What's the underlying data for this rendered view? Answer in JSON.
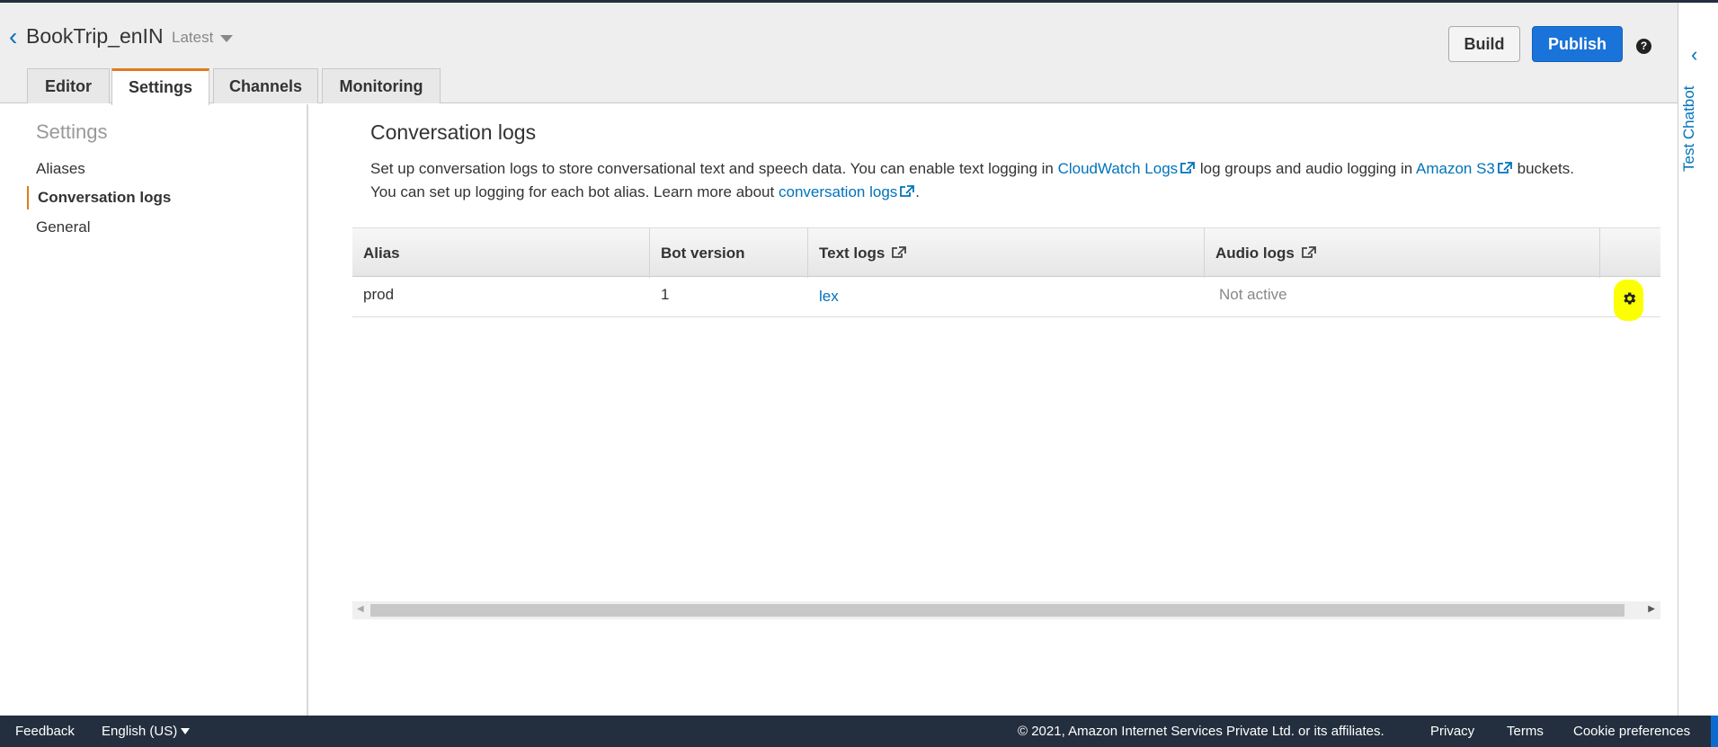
{
  "header": {
    "bot_name": "BookTrip_enIN",
    "version": "Latest",
    "build_label": "Build",
    "publish_label": "Publish",
    "help": "?",
    "tabs": [
      {
        "label": "Editor"
      },
      {
        "label": "Settings"
      },
      {
        "label": "Channels"
      },
      {
        "label": "Monitoring"
      }
    ]
  },
  "right_panel": {
    "label": "Test Chatbot"
  },
  "sidebar": {
    "title": "Settings",
    "items": [
      {
        "label": "Aliases"
      },
      {
        "label": "Conversation logs"
      },
      {
        "label": "General"
      }
    ]
  },
  "main": {
    "title": "Conversation logs",
    "desc1_a": "Set up conversation logs to store conversational text and speech data. You can enable text logging in",
    "desc1_link1": "CloudWatch Logs",
    "desc1_b": "log groups and audio logging in",
    "desc1_link2": "Amazon S3",
    "desc1_c": "buckets.",
    "desc2_a": "You can set up logging for each bot alias. Learn more about",
    "desc2_link": "conversation logs",
    "desc2_b": "."
  },
  "table": {
    "headers": [
      "Alias",
      "Bot version",
      "Text logs",
      "Audio logs"
    ],
    "rows": [
      {
        "alias": "prod",
        "bot_version": "1",
        "text_logs": "lex",
        "audio_logs": "Not active"
      }
    ]
  },
  "footer": {
    "feedback": "Feedback",
    "language": "English (US)",
    "copyright": "© 2021, Amazon Internet Services Private Ltd. or its affiliates.",
    "privacy": "Privacy",
    "terms": "Terms",
    "cookie": "Cookie preferences"
  },
  "colors": {
    "link": "#0073bb",
    "publish_button": "#1a73d9",
    "active_tab_accent": "#e07b1a",
    "footer_bg": "#232f3e",
    "highlight": "#fbff00"
  }
}
